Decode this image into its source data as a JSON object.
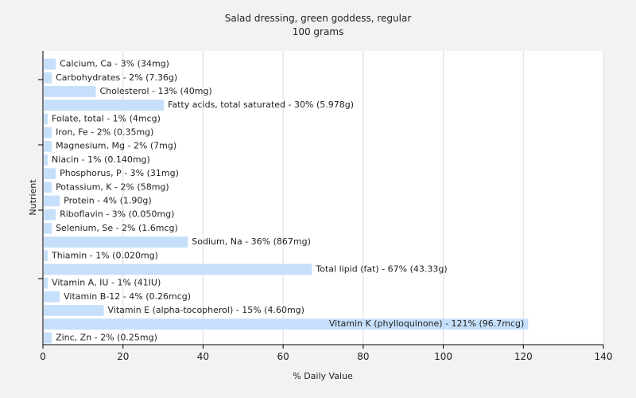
{
  "chart_data": {
    "type": "bar",
    "orientation": "horizontal",
    "title": "Salad dressing, green goddess, regular",
    "subtitle": "100 grams",
    "xlabel": "% Daily Value",
    "ylabel": "Nutrient",
    "xlim": [
      0,
      140
    ],
    "xticks": [
      0,
      20,
      40,
      60,
      80,
      100,
      120,
      140
    ],
    "grid": true,
    "bar_color": "#c6e0fb",
    "categories": [
      "Calcium, Ca",
      "Carbohydrates",
      "Cholesterol",
      "Fatty acids, total saturated",
      "Folate, total",
      "Iron, Fe",
      "Magnesium, Mg",
      "Niacin",
      "Phosphorus, P",
      "Potassium, K",
      "Protein",
      "Riboflavin",
      "Selenium, Se",
      "Sodium, Na",
      "Thiamin",
      "Total lipid (fat)",
      "Vitamin A, IU",
      "Vitamin B-12",
      "Vitamin E (alpha-tocopherol)",
      "Vitamin K (phylloquinone)",
      "Zinc, Zn"
    ],
    "values": [
      3,
      2,
      13,
      30,
      1,
      2,
      2,
      1,
      3,
      2,
      4,
      3,
      2,
      36,
      1,
      67,
      1,
      4,
      15,
      121,
      2
    ],
    "labels": [
      "Calcium, Ca - 3% (34mg)",
      "Carbohydrates - 2% (7.36g)",
      "Cholesterol - 13% (40mg)",
      "Fatty acids, total saturated - 30% (5.978g)",
      "Folate, total - 1% (4mcg)",
      "Iron, Fe - 2% (0.35mg)",
      "Magnesium, Mg - 2% (7mg)",
      "Niacin - 1% (0.140mg)",
      "Phosphorus, P - 3% (31mg)",
      "Potassium, K - 2% (58mg)",
      "Protein - 4% (1.90g)",
      "Riboflavin - 3% (0.050mg)",
      "Selenium, Se - 2% (1.6mcg)",
      "Sodium, Na - 36% (867mg)",
      "Thiamin - 1% (0.020mg)",
      "Total lipid (fat) - 67% (43.33g)",
      "Vitamin A, IU - 1% (41IU)",
      "Vitamin B-12 - 4% (0.26mcg)",
      "Vitamin E (alpha-tocopherol) - 15% (4.60mg)",
      "Vitamin K (phylloquinone) - 121% (96.7mcg)",
      "Zinc, Zn - 2% (0.25mg)"
    ]
  }
}
